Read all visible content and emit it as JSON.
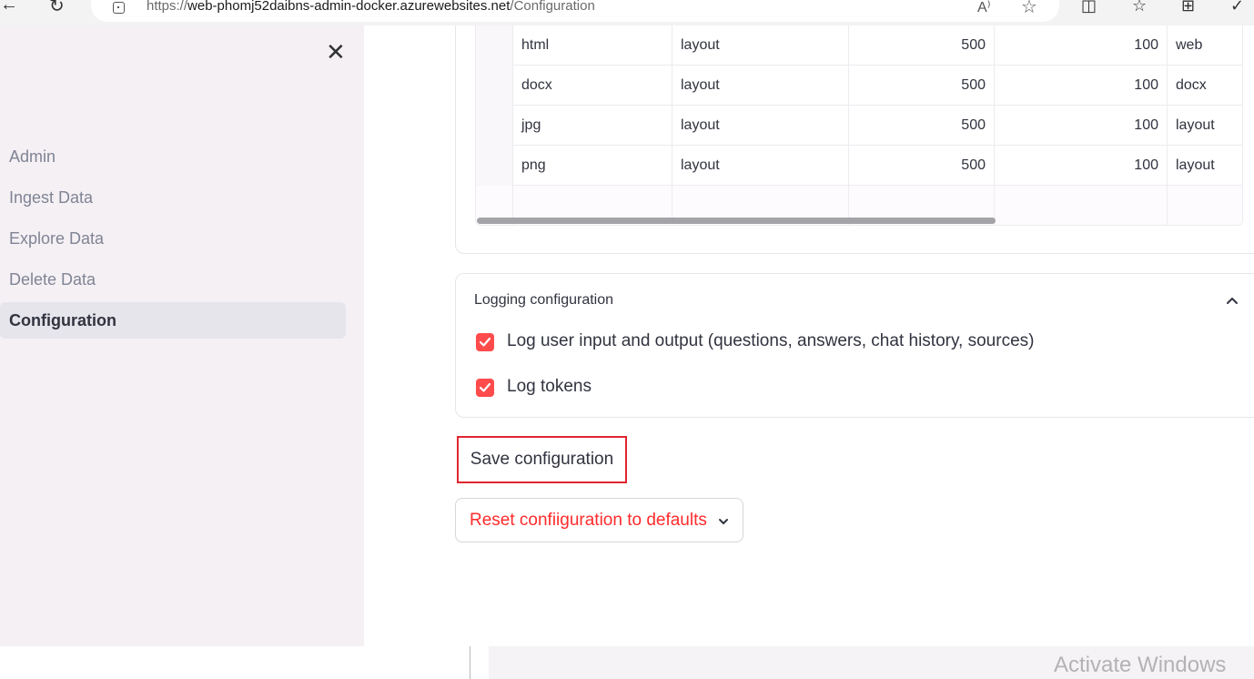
{
  "browser": {
    "url_prefix": "https://",
    "url_host": "web-phomj52daibns-admin-docker.azurewebsites.net",
    "url_path": "/Configuration",
    "read_aloud_icon": "A⁾"
  },
  "sidebar": {
    "items": [
      {
        "label": "Admin"
      },
      {
        "label": "Ingest Data"
      },
      {
        "label": "Explore Data"
      },
      {
        "label": "Delete Data"
      },
      {
        "label": "Configuration",
        "active": true
      }
    ]
  },
  "table": {
    "rows": [
      {
        "ext": "html",
        "strategy": "layout",
        "size": "500",
        "overlap": "100",
        "loader": "web"
      },
      {
        "ext": "docx",
        "strategy": "layout",
        "size": "500",
        "overlap": "100",
        "loader": "docx"
      },
      {
        "ext": "jpg",
        "strategy": "layout",
        "size": "500",
        "overlap": "100",
        "loader": "layout"
      },
      {
        "ext": "png",
        "strategy": "layout",
        "size": "500",
        "overlap": "100",
        "loader": "layout"
      }
    ]
  },
  "logging": {
    "title": "Logging configuration",
    "options": [
      {
        "label": "Log user input and output (questions, answers, chat history, sources)",
        "checked": true
      },
      {
        "label": "Log tokens",
        "checked": true
      }
    ]
  },
  "actions": {
    "save_label": "Save configuration",
    "reset_label": "Reset confiiguration to defaults"
  },
  "watermark": "Activate Windows",
  "colors": {
    "accent": "#ff4b4b",
    "highlight_border": "#e0262f",
    "sidebar_bg": "#f4f0f4"
  }
}
